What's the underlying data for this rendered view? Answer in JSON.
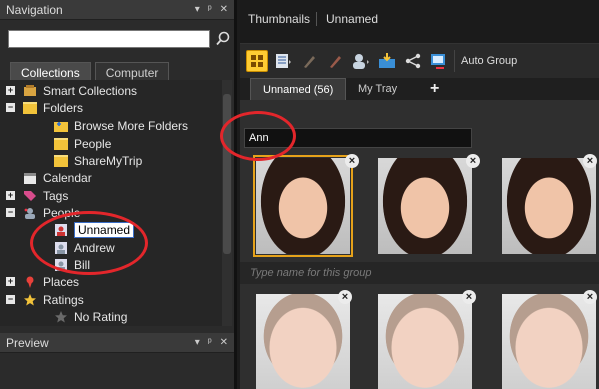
{
  "navigation": {
    "title": "Navigation",
    "controls": [
      "▾",
      "ᵖ",
      "✕"
    ],
    "search": {
      "value": "",
      "placeholder": ""
    },
    "tabs": [
      {
        "label": "Collections"
      },
      {
        "label": "Computer"
      }
    ],
    "tree": [
      {
        "label": "Smart Collections",
        "icon": "smart-collections-icon"
      },
      {
        "label": "Folders",
        "icon": "folder-icon"
      },
      {
        "label": "Browse More Folders",
        "icon": "add-folder-icon"
      },
      {
        "label": "People",
        "icon": "folder-icon"
      },
      {
        "label": "ShareMyTrip",
        "icon": "folder-icon"
      },
      {
        "label": "Calendar",
        "icon": "calendar-icon"
      },
      {
        "label": "Tags",
        "icon": "tag-icon"
      },
      {
        "label": "People",
        "icon": "people-icon"
      },
      {
        "label": "Unnamed",
        "icon": "person-icon"
      },
      {
        "label": "Andrew",
        "icon": "person-icon"
      },
      {
        "label": "Bill",
        "icon": "person-icon"
      },
      {
        "label": "Places",
        "icon": "place-pin-icon"
      },
      {
        "label": "Ratings",
        "icon": "star-icon"
      },
      {
        "label": "No Rating",
        "icon": "star-icon"
      }
    ]
  },
  "preview": {
    "title": "Preview",
    "controls": [
      "▾",
      "ᵖ",
      "✕"
    ]
  },
  "thumbnails": {
    "tabs": [
      {
        "label": "Thumbnails"
      },
      {
        "label": "Unnamed"
      }
    ],
    "toolbar": {
      "auto_group_label": "Auto Group"
    },
    "content_tabs": [
      {
        "label": "Unnamed (56)"
      },
      {
        "label": "My Tray"
      },
      {
        "label": "+"
      }
    ],
    "group_name_value": "Ann",
    "group_name_placeholder": "Type name for this group",
    "accent_color": "#ffcc33",
    "annotation_color": "#e3262b"
  }
}
